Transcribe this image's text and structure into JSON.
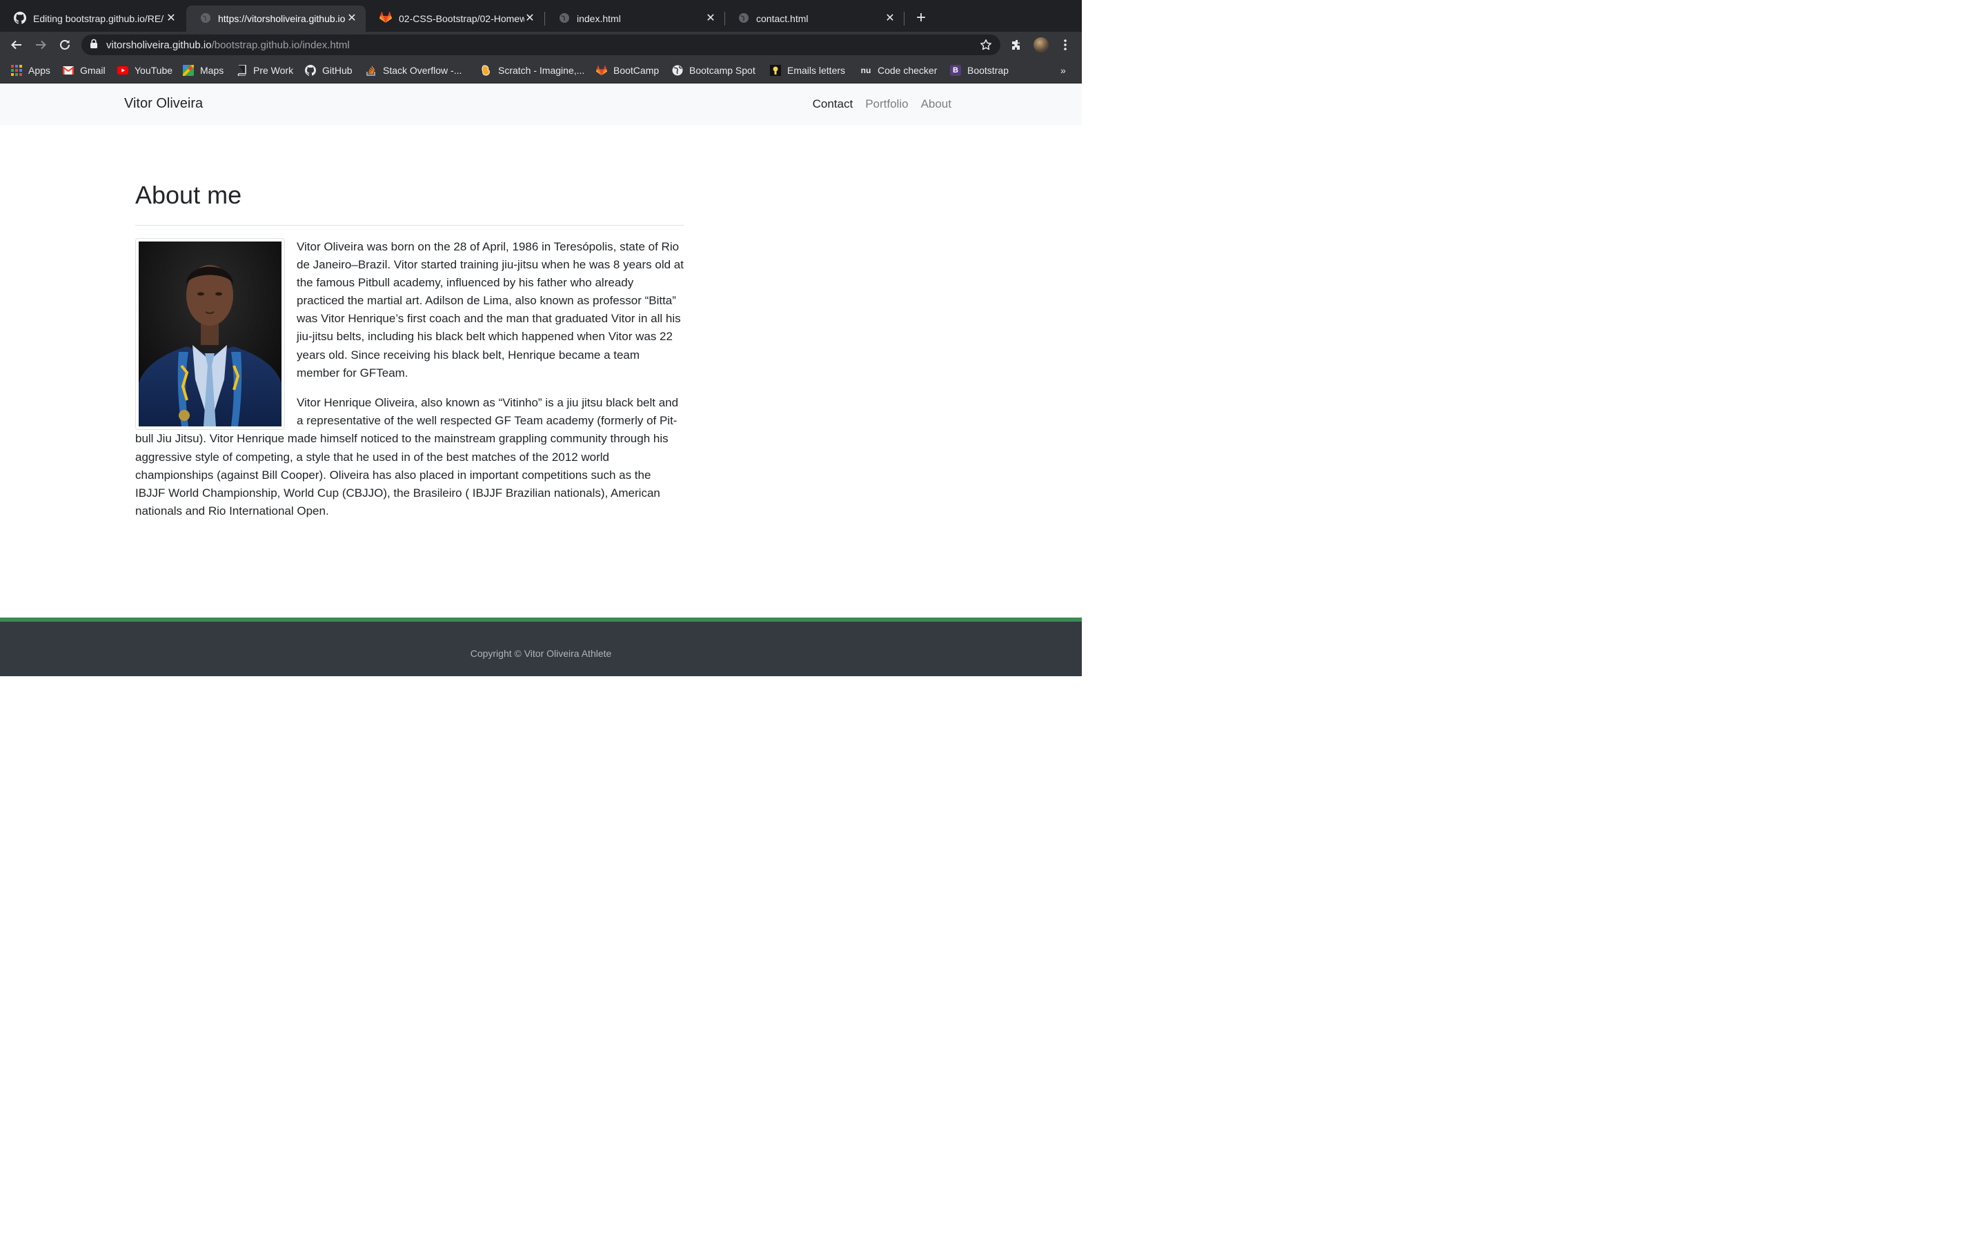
{
  "browser": {
    "tabs": [
      {
        "title": "Editing bootstrap.github.io/RE/",
        "icon": "github-icon",
        "active": false
      },
      {
        "title": "https://vitorsholiveira.github.io",
        "icon": "globe-icon",
        "active": true
      },
      {
        "title": "02-CSS-Bootstrap/02-Homew",
        "icon": "gitlab-icon",
        "active": false
      },
      {
        "title": "index.html",
        "icon": "globe-icon",
        "active": false
      },
      {
        "title": "contact.html",
        "icon": "globe-icon",
        "active": false
      }
    ],
    "close_glyph": "✕",
    "new_tab_glyph": "+",
    "address": {
      "host": "vitorsholiveira.github.io",
      "path": "/bootstrap.github.io/index.html"
    },
    "bookmarks": [
      {
        "label": "Apps",
        "icon": "apps-grid-icon"
      },
      {
        "label": "Gmail",
        "icon": "gmail-icon"
      },
      {
        "label": "YouTube",
        "icon": "youtube-icon"
      },
      {
        "label": "Maps",
        "icon": "maps-icon"
      },
      {
        "label": "Pre Work",
        "icon": "book-icon"
      },
      {
        "label": "GitHub",
        "icon": "github-icon"
      },
      {
        "label": "Stack Overflow -...",
        "icon": "stackoverflow-icon"
      },
      {
        "label": "Scratch - Imagine,...",
        "icon": "scratch-icon"
      },
      {
        "label": "BootCamp",
        "icon": "gitlab-icon"
      },
      {
        "label": "Bootcamp Spot",
        "icon": "globe-icon"
      },
      {
        "label": "Emails letters",
        "icon": "bulb-icon"
      },
      {
        "label": "Code checker",
        "icon": "nu-icon"
      },
      {
        "label": "Bootstrap",
        "icon": "bootstrap-icon"
      }
    ],
    "bookmarks_more": "»"
  },
  "site": {
    "brand": "Vitor Oliveira",
    "nav": [
      "Contact",
      "Portfolio",
      "About"
    ],
    "about": {
      "title": "About me",
      "paragraph_1": "Vitor Oliveira was born on the 28 of April, 1986 in Teresópolis, state of Rio de Janeiro–Brazil. Vitor started training jiu-jitsu when he was 8 years old at the famous Pitbull academy, influenced by his father who already practiced the martial art. Adilson de Lima, also known as professor “Bitta” was Vitor Henrique’s first coach and the man that graduated Vitor in all his jiu-jitsu belts, including his black belt which happened when Vitor was 22 years old. Since receiving his black belt, Henrique became a team member for GFTeam.",
      "paragraph_2": "Vitor Henrique Oliveira, also known as “Vitinho” is a jiu jitsu black belt and a representative of the well respected GF Team academy (formerly of Pit-bull Jiu Jitsu). Vitor Henrique made himself noticed to the mainstream grappling community through his aggressive style of competing, a style that he used in of the best matches of the 2012 world championships (against Bill Cooper). Oliveira has also placed in important competitions such as the IBJJF World Championship, World Cup (CBJJO), the Brasileiro ( IBJJF Brazilian nationals), American nationals and Rio International Open."
    },
    "footer": "Copyright © Vitor Oliveira Athlete"
  },
  "colors": {
    "chrome_dark": "#202124",
    "chrome_toolbar": "#35363a",
    "nav_bg": "#f8f9fa",
    "footer_bg": "#343a40",
    "footer_accent": "#3c8a55"
  }
}
